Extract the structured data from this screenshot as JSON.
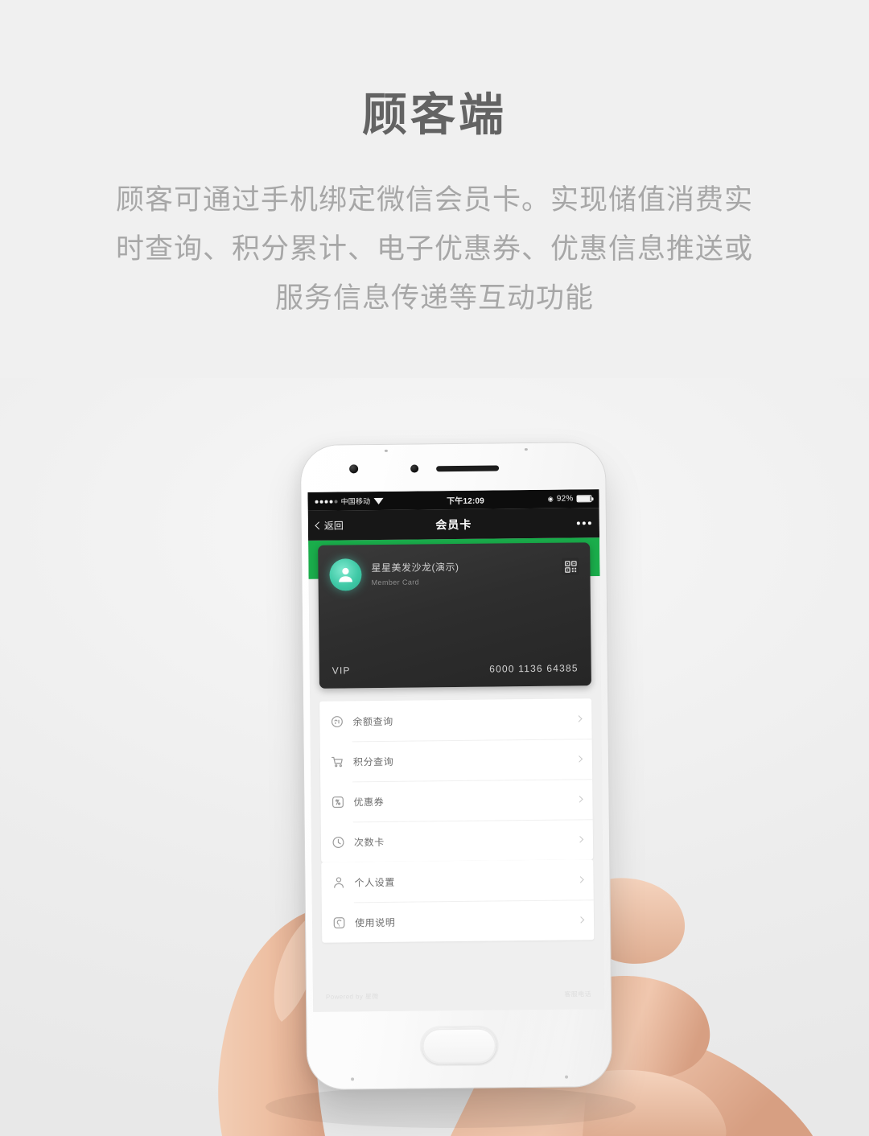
{
  "page": {
    "title": "顾客端",
    "description_lines": [
      "顾客可通过手机绑定微信会员卡。实现储值消费实",
      "时查询、积分累计、电子优惠券、优惠信息推送或",
      "服务信息传递等互动功能"
    ]
  },
  "colors": {
    "background": "#f0f0f0",
    "title_text": "#636363",
    "body_text": "#a7a7a7",
    "wechat_green": "#1aad4b",
    "card_dark": "#2e2e2e",
    "avatar_teal": "#3fc9a6",
    "statusbar_black": "#0d0d0d",
    "navbar_black": "#171717"
  },
  "phone": {
    "statusbar": {
      "carrier": "中国移动",
      "signal_icon": "signal-dots-icon",
      "wifi_icon": "wifi-icon",
      "time": "下午12:09",
      "lock_icon": "rotation-lock-icon",
      "battery_percent": "92%",
      "battery_icon": "battery-icon"
    },
    "navbar": {
      "back_icon": "chevron-left-icon",
      "back_label": "返回",
      "title": "会员卡",
      "more_icon": "more-dots-icon"
    },
    "card": {
      "avatar_icon": "person-avatar-icon",
      "shop_name": "星星美发沙龙(演示)",
      "card_type_label": "Member Card",
      "qr_icon": "qr-code-icon",
      "tier_label": "VIP",
      "card_number": "6000 1136 64385"
    },
    "menu_groups": [
      {
        "items": [
          {
            "icon": "wallet-balance-icon",
            "label": "余额查询",
            "chevron": "chevron-right-icon"
          },
          {
            "icon": "points-cart-icon",
            "label": "积分查询",
            "chevron": "chevron-right-icon"
          },
          {
            "icon": "coupon-icon",
            "label": "优惠券",
            "chevron": "chevron-right-icon"
          },
          {
            "icon": "times-card-icon",
            "label": "次数卡",
            "chevron": "chevron-right-icon"
          }
        ]
      },
      {
        "items": [
          {
            "icon": "person-settings-icon",
            "label": "个人设置",
            "chevron": "chevron-right-icon"
          },
          {
            "icon": "help-manual-icon",
            "label": "使用说明",
            "chevron": "chevron-right-icon"
          }
        ]
      }
    ],
    "footer": {
      "left": "Powered by 星微",
      "right": "客服电话"
    },
    "home_button_icon": "home-button-icon"
  }
}
